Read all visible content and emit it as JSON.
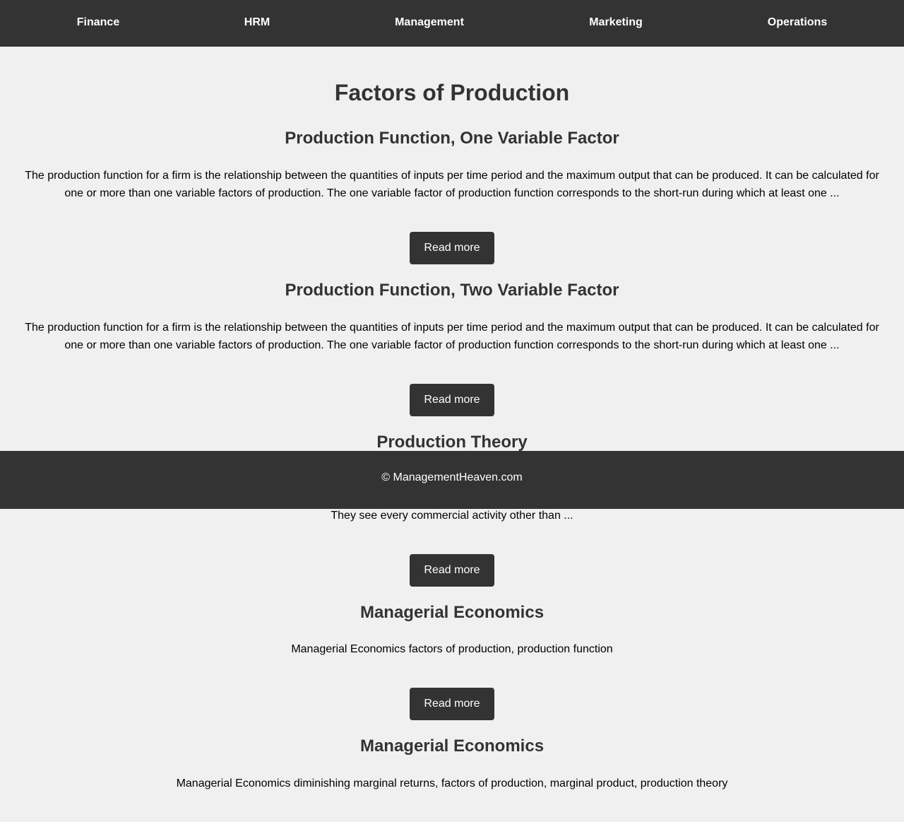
{
  "nav": {
    "items": [
      "Finance",
      "HRM",
      "Management",
      "Marketing",
      "Operations"
    ]
  },
  "page": {
    "title": "Factors of Production"
  },
  "articles": [
    {
      "title": "Production Function, One Variable Factor",
      "excerpt_line1": "The production function for a firm is the relationship between the quantities of inputs per time period and the maximum output that can be produced. It can be calculated for",
      "excerpt_line2": "one or more than one variable factors of production. The one variable factor of production function corresponds to the short-run during which at least one ...",
      "button": "Read more"
    },
    {
      "title": "Production Function, Two Variable Factor",
      "excerpt_line1": "The production function for a firm is the relationship between the quantities of inputs per time period and the maximum output that can be produced. It can be calculated for",
      "excerpt_line2": "one or more than one variable factors of production. The one variable factor of production function corresponds to the short-run during which at least one ...",
      "button": "Read more"
    },
    {
      "title": "Production Theory",
      "excerpt_line2": "They see every commercial activity other than ...",
      "button": "Read more"
    },
    {
      "title": "Managerial Economics",
      "excerpt": "Managerial Economics factors of production, production function",
      "button": "Read more"
    },
    {
      "title": "Managerial Economics",
      "excerpt": "Managerial Economics diminishing marginal returns, factors of production, marginal product, production theory"
    }
  ],
  "footer": {
    "text": "© ManagementHeaven.com"
  },
  "colors": {
    "nav_bg": "#333333",
    "page_bg": "#f0f0f0",
    "heading": "#333333",
    "button_bg": "#333333"
  }
}
